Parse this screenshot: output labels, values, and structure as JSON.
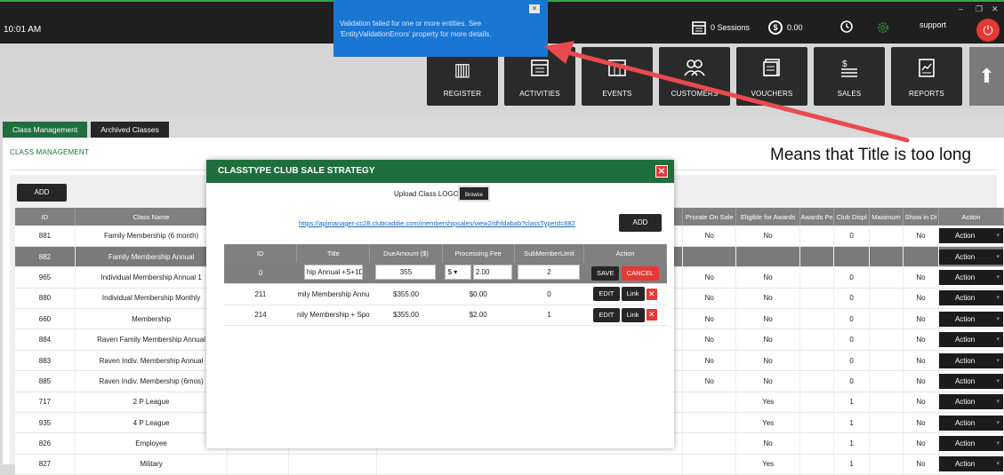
{
  "topbar": {
    "time": "10:01 AM",
    "sessions": "0 Sessions",
    "balance": "0.00",
    "user": "support",
    "win_min": "–",
    "win_restore": "❐",
    "win_close": "✕"
  },
  "toast": {
    "message": "Validation failed for one or more entities. See 'EntityValidationErrors' property for more details."
  },
  "nav": [
    {
      "label": "REGISTER",
      "icon": "barcode-scanner-icon"
    },
    {
      "label": "ACTIVITIES",
      "icon": "calendar-icon"
    },
    {
      "label": "EVENTS",
      "icon": "calendar-events-icon"
    },
    {
      "label": "CUSTOMERS",
      "icon": "users-icon"
    },
    {
      "label": "VOUCHERS",
      "icon": "voucher-icon"
    },
    {
      "label": "SALES",
      "icon": "sales-icon"
    },
    {
      "label": "REPORTS",
      "icon": "reports-icon"
    }
  ],
  "tabs": {
    "active": "Class Management",
    "inactive": "Archived Classes"
  },
  "panel": {
    "title": "CLASS MANAGEMENT",
    "add_label": "ADD"
  },
  "table": {
    "headers": [
      "ID",
      "Class Name",
      "",
      "",
      "",
      "Prorate On Sale",
      "Eligible for Awards",
      "Awards Pe",
      "Club Displ",
      "Maximum",
      "Show in Di",
      "Action"
    ],
    "rows": [
      {
        "id": "881",
        "name": "Family Membership (6 month)",
        "prorate": "No",
        "awards": "No",
        "club": "0",
        "show": "No",
        "action": "Action"
      },
      {
        "id": "882",
        "name": "Family Membership Annual",
        "prorate": "",
        "awards": "",
        "club": "",
        "show": "",
        "action": "Action"
      },
      {
        "id": "965",
        "name": "Individual Membership Annual 1",
        "prorate": "No",
        "awards": "No",
        "club": "0",
        "show": "No",
        "action": "Action"
      },
      {
        "id": "880",
        "name": "Individual Membership Monthly",
        "prorate": "No",
        "awards": "No",
        "club": "0",
        "show": "No",
        "action": "Action"
      },
      {
        "id": "660",
        "name": "Membership",
        "prorate": "No",
        "awards": "No",
        "club": "0",
        "show": "No",
        "action": "Action"
      },
      {
        "id": "884",
        "name": "Raven Family Membership Annual",
        "prorate": "No",
        "awards": "No",
        "club": "0",
        "show": "No",
        "action": "Action"
      },
      {
        "id": "883",
        "name": "Raven Indiv. Membership Annual",
        "prorate": "No",
        "awards": "No",
        "club": "0",
        "show": "No",
        "action": "Action"
      },
      {
        "id": "885",
        "name": "Raven Indiv. Membership (6mos)",
        "prorate": "No",
        "awards": "No",
        "club": "0",
        "show": "No",
        "action": "Action"
      },
      {
        "id": "717",
        "name": "2 P League",
        "prorate": "",
        "awards": "Yes",
        "club": "1",
        "show": "No",
        "action": "Action"
      },
      {
        "id": "935",
        "name": "4 P League",
        "prorate": "",
        "awards": "Yes",
        "club": "1",
        "show": "No",
        "action": "Action"
      },
      {
        "id": "826",
        "name": "Employee",
        "prorate": "",
        "awards": "No",
        "club": "1",
        "show": "No",
        "action": "Action"
      },
      {
        "id": "827",
        "name": "Military",
        "prorate": "",
        "awards": "Yes",
        "club": "1",
        "show": "No",
        "action": "Action"
      }
    ]
  },
  "modal": {
    "title": "CLASSTYPE CLUB SALE STRATEGY",
    "close": "✕",
    "upload_label": "Upload Class LOGO",
    "browse_label": "Browse",
    "url": "https://apimanager-cc28.clubcaddie.com/membershipsales/view2/dhfdabab?classTypeId=882",
    "add_label": "ADD",
    "headers": [
      "ID",
      "Title",
      "DueAmount ($)",
      "Processing Fee",
      "SubMemberLimit",
      "Action"
    ],
    "edit_row": {
      "id": "0",
      "title": "hip Annual +S+1D",
      "due": "355",
      "fee_type": "$",
      "fee": "2.00",
      "limit": "2",
      "save": "SAVE",
      "cancel": "CANCEL"
    },
    "rows": [
      {
        "id": "211",
        "title": "mily Membership Annu",
        "due": "$355.00",
        "fee": "$0.00",
        "limit": "0",
        "edit": "EDIT",
        "link": "Link",
        "del": "✕"
      },
      {
        "id": "214",
        "title": "nily Membership + Spo",
        "due": "$355.00",
        "fee": "$2.00",
        "limit": "1",
        "edit": "EDIT",
        "link": "Link",
        "del": "✕"
      }
    ]
  },
  "annotation": {
    "text": "Means that Title is too long",
    "color": "#e84a4f"
  },
  "colors": {
    "brand_green": "#1f6e3d",
    "danger": "#e53935",
    "toast_blue": "#1976d2"
  }
}
